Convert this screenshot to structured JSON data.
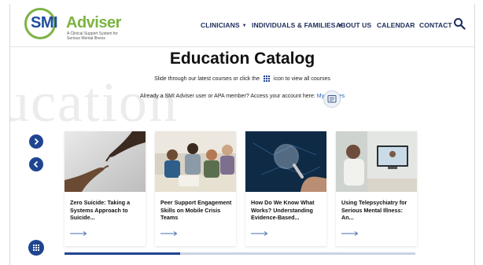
{
  "header": {
    "logo": {
      "brand_smi": "SMI",
      "brand_adviser": "Adviser",
      "tagline": "A Clinical Support System for Serious Mental Illness"
    },
    "nav": [
      {
        "label": "CLINICIANS",
        "has_dropdown": true
      },
      {
        "label": "INDIVIDUALS & FAMILIES",
        "has_dropdown": true
      },
      {
        "label": "ABOUT US",
        "has_dropdown": false
      },
      {
        "label": "CALENDAR",
        "has_dropdown": false
      },
      {
        "label": "CONTACT",
        "has_dropdown": false
      }
    ],
    "search_icon": "search-icon"
  },
  "watermark": "ucation",
  "main": {
    "title": "Education Catalog",
    "subtitle_before": "Slide through our latest courses or click the",
    "subtitle_after": "icon to view all courses",
    "member_text": "Already a SMI Adviser user or APA member? Access your account here:",
    "member_link": "MyCourses"
  },
  "cards": [
    {
      "title": "Zero Suicide: Taking a Systems Approach to Suicide...",
      "image": "hands-reaching-image"
    },
    {
      "title": "Peer Support Engagement Skills on Mobile Crisis Teams",
      "image": "group-meeting-image"
    },
    {
      "title": "How Do We Know What Works? Understanding Evidence-Based...",
      "image": "magnifier-network-image"
    },
    {
      "title": "Using Telepsychiatry for Serious Mental Illness: An...",
      "image": "telehealth-image"
    }
  ],
  "carousel": {
    "progress": 0.33
  },
  "colors": {
    "navy": "#1f4591",
    "brand_green": "#7cb342",
    "link_blue": "#1f5fb4",
    "nav_text": "#1d2c5a"
  }
}
